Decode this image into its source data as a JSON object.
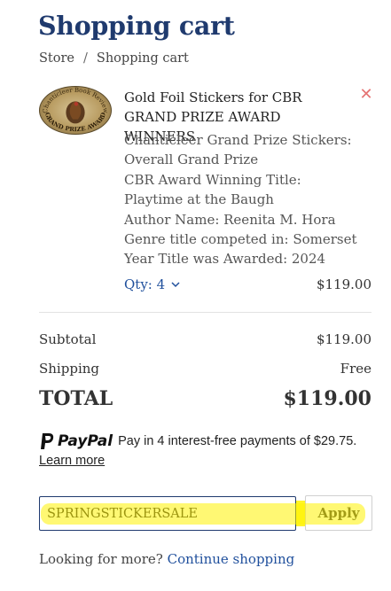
{
  "page": {
    "title": "Shopping cart"
  },
  "breadcrumb": {
    "items": [
      "Store",
      "Shopping cart"
    ],
    "separator": "/"
  },
  "cart_item": {
    "image_text": [
      "Chanticleer Book Review",
      "GRAND PRIZE AWARD"
    ],
    "title": "Gold Foil Stickers for CBR GRAND PRIZE AWARD WINNERS",
    "properties": [
      "Chanticleer Grand Prize Stickers: Overall Grand Prize",
      "CBR Award Winning Title: Playtime at the Baugh",
      "Author Name: Reenita M. Hora",
      "Genre title competed in: Somerset",
      "Year Title was Awarded: 2024"
    ],
    "quantity_label": "Qty: 4",
    "price": "$119.00",
    "remove_icon": "close-icon"
  },
  "summary": {
    "subtotal_label": "Subtotal",
    "subtotal_value": "$119.00",
    "shipping_label": "Shipping",
    "shipping_value": "Free",
    "total_label": "TOTAL",
    "total_value": "$119.00"
  },
  "paypal": {
    "brand": "PayPal",
    "message": "Pay in 4 interest-free payments of $29.75.",
    "learn_more": "Learn more"
  },
  "discount": {
    "code_value": "SPRINGSTICKERSALE",
    "apply_label": "Apply"
  },
  "footer": {
    "prompt": "Looking for more?",
    "link": "Continue shopping"
  },
  "colors": {
    "heading": "#1f3a6e",
    "link": "#1f4f9c",
    "remove": "#e57373",
    "highlight": "#fff300"
  }
}
